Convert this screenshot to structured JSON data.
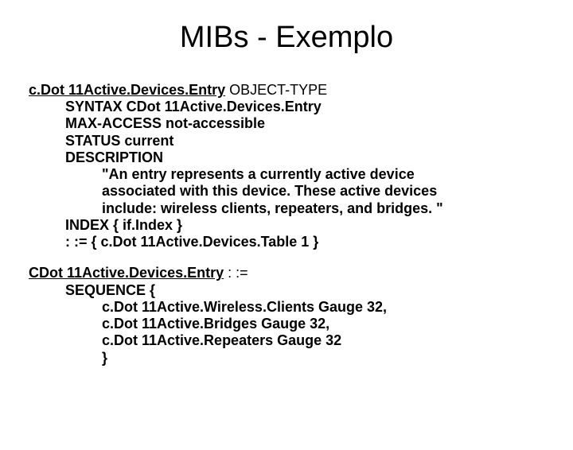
{
  "title": "MIBs - Exemplo",
  "block1": {
    "l0a": "c.Dot 11Active.Devices.Entry",
    "l0b": " OBJECT-TYPE",
    "l1": "SYNTAX      CDot 11Active.Devices.Entry",
    "l2": "MAX-ACCESS not-accessible",
    "l3": "STATUS     current",
    "l4": "DESCRIPTION",
    "l5": "\"An entry represents a currently active device",
    "l6": "associated with this device.  These active devices",
    "l7": "include: wireless clients, repeaters, and bridges. \"",
    "l8": "INDEX        { if.Index }",
    "l9": ": := { c.Dot 11Active.Devices.Table 1 }"
  },
  "block2": {
    "l0a": "CDot 11Active.Devices.Entry",
    "l0b": " : :=",
    "l1": "SEQUENCE   {",
    "l2": "c.Dot 11Active.Wireless.Clients  Gauge 32,",
    "l3": "c.Dot 11Active.Bridges           Gauge 32,",
    "l4": "c.Dot 11Active.Repeaters          Gauge 32",
    "l5": "  }"
  }
}
